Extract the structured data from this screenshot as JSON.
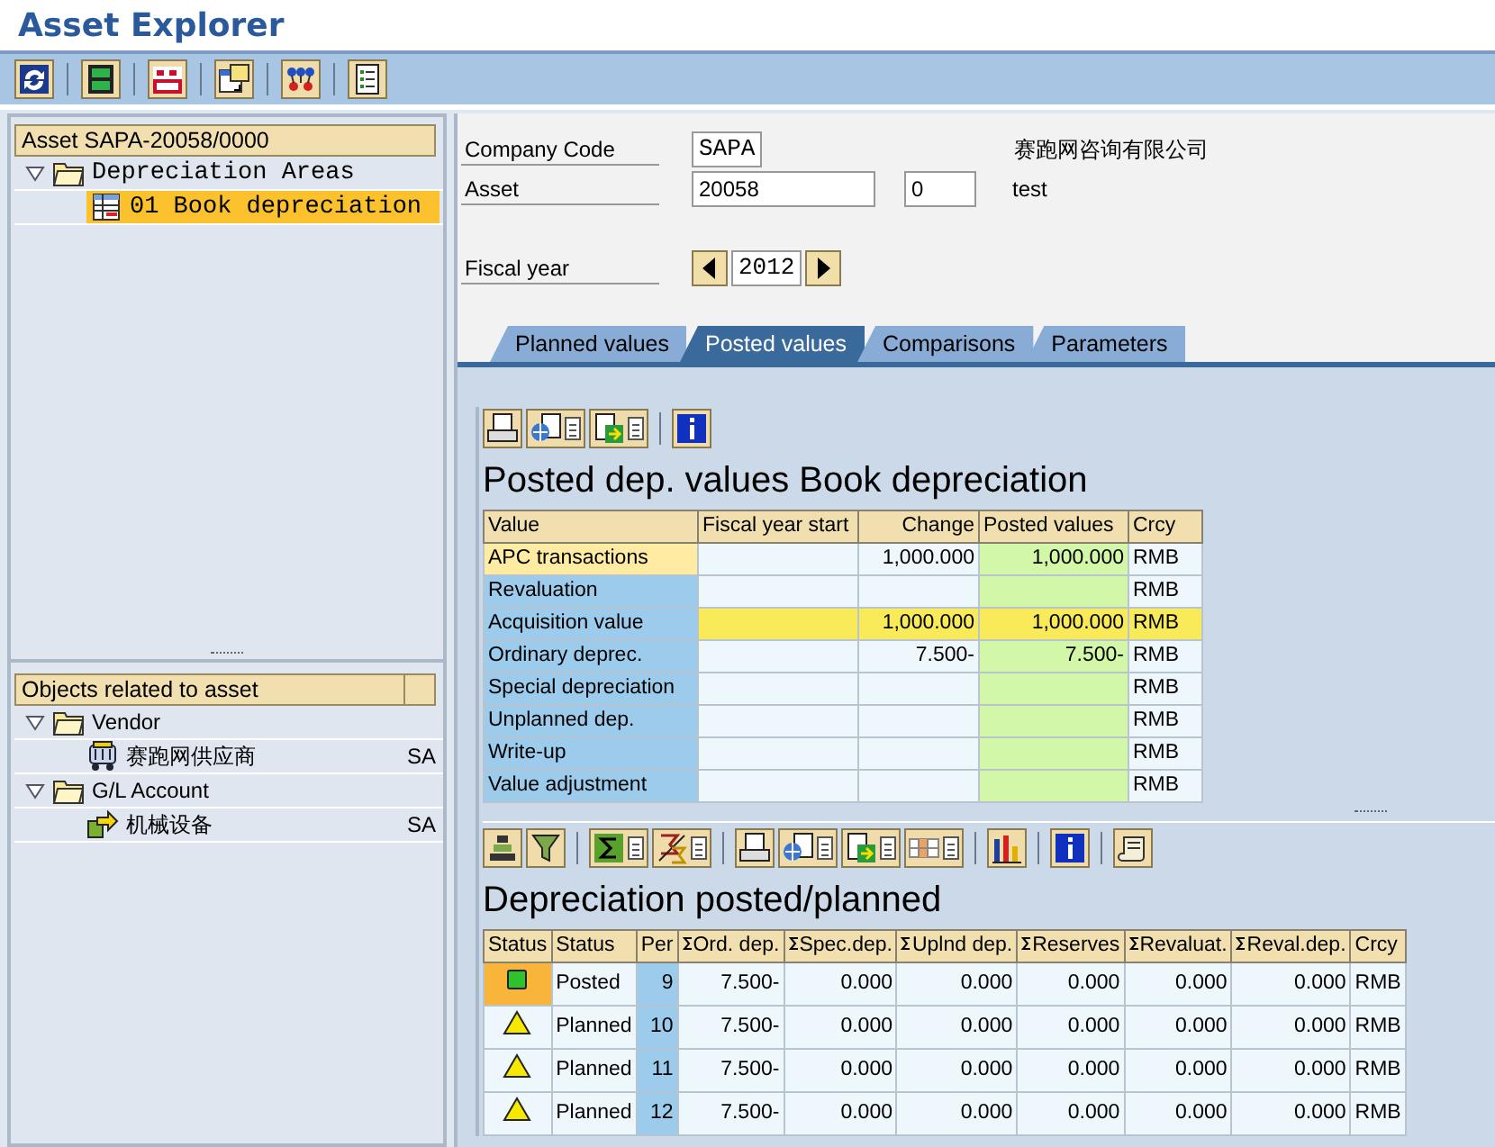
{
  "window": {
    "title": "Asset Explorer"
  },
  "tree": {
    "header": "Asset SAPA-20058/0000",
    "items": [
      {
        "label": "Depreciation Areas",
        "expanded": true,
        "children": [
          {
            "label": "01 Book depreciation",
            "selected": true
          }
        ]
      }
    ]
  },
  "objects": {
    "header": "Objects related to asset",
    "items": [
      {
        "label": "Vendor",
        "expanded": true,
        "children": [
          {
            "kind": "vendor",
            "label": "赛跑网供应商",
            "code": "SA"
          }
        ]
      },
      {
        "label": "G/L Account",
        "expanded": true,
        "children": [
          {
            "kind": "account",
            "label": "机械设备",
            "code": "SA"
          }
        ]
      }
    ]
  },
  "form": {
    "company_code": {
      "label": "Company Code",
      "value": "SAPA",
      "description": "赛跑网咨询有限公司"
    },
    "asset": {
      "label": "Asset",
      "value": "20058",
      "subnumber": "0",
      "description": "test"
    },
    "fiscal_year": {
      "label": "Fiscal year",
      "value": "2012"
    }
  },
  "tabs": [
    {
      "label": "Planned values",
      "selected": false
    },
    {
      "label": "Posted values",
      "selected": true
    },
    {
      "label": "Comparisons",
      "selected": false
    },
    {
      "label": "Parameters",
      "selected": false
    }
  ],
  "posted_table": {
    "title": "Posted dep. values Book depreciation",
    "columns": [
      "Value",
      "Fiscal year start",
      "Change",
      "Posted values",
      "Crcy"
    ],
    "rows": [
      {
        "kind": "item",
        "selected": true,
        "cells": [
          "APC transactions",
          "",
          "1,000.000",
          "1,000.000",
          "RMB"
        ]
      },
      {
        "kind": "item",
        "selected": false,
        "cells": [
          "Revaluation",
          "",
          "",
          "",
          "RMB"
        ]
      },
      {
        "kind": "total",
        "selected": false,
        "cells": [
          "Acquisition value",
          "",
          "1,000.000",
          "1,000.000",
          "RMB"
        ]
      },
      {
        "kind": "item",
        "selected": false,
        "cells": [
          "Ordinary deprec.",
          "",
          "7.500-",
          "7.500-",
          "RMB"
        ]
      },
      {
        "kind": "item",
        "selected": false,
        "cells": [
          "Special depreciation",
          "",
          "",
          "",
          "RMB"
        ]
      },
      {
        "kind": "item",
        "selected": false,
        "cells": [
          "Unplanned dep.",
          "",
          "",
          "",
          "RMB"
        ]
      },
      {
        "kind": "item",
        "selected": false,
        "cells": [
          "Write-up",
          "",
          "",
          "",
          "RMB"
        ]
      },
      {
        "kind": "item",
        "selected": false,
        "cells": [
          "Value adjustment",
          "",
          "",
          "",
          "RMB"
        ]
      }
    ]
  },
  "depreciation_table": {
    "title": "Depreciation posted/planned",
    "columns": [
      {
        "label": "Status",
        "summed": false
      },
      {
        "label": "Status",
        "summed": false
      },
      {
        "label": "Per",
        "summed": false
      },
      {
        "label": "Ord. dep.",
        "summed": true
      },
      {
        "label": "Spec.dep.",
        "summed": true
      },
      {
        "label": "Uplnd dep.",
        "summed": true
      },
      {
        "label": "Reserves",
        "summed": true
      },
      {
        "label": "Revaluat.",
        "summed": true
      },
      {
        "label": "Reval.dep.",
        "summed": true
      },
      {
        "label": "Crcy",
        "summed": false
      }
    ],
    "rows": [
      {
        "kind": "posted",
        "selected": true,
        "cells": [
          "",
          "Posted",
          "9",
          "7.500-",
          "0.000",
          "0.000",
          "0.000",
          "0.000",
          "0.000",
          "RMB"
        ]
      },
      {
        "kind": "planned",
        "selected": false,
        "cells": [
          "",
          "Planned",
          "10",
          "7.500-",
          "0.000",
          "0.000",
          "0.000",
          "0.000",
          "0.000",
          "RMB"
        ]
      },
      {
        "kind": "planned",
        "selected": false,
        "cells": [
          "",
          "Planned",
          "11",
          "7.500-",
          "0.000",
          "0.000",
          "0.000",
          "0.000",
          "0.000",
          "RMB"
        ]
      },
      {
        "kind": "planned",
        "selected": false,
        "cells": [
          "",
          "Planned",
          "12",
          "7.500-",
          "0.000",
          "0.000",
          "0.000",
          "0.000",
          "0.000",
          "RMB"
        ]
      }
    ]
  }
}
